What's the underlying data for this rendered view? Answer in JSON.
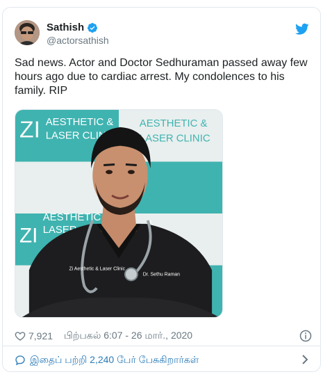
{
  "tweet": {
    "author_name": "Sathish",
    "author_handle": "@actorsathish",
    "text": "Sad news. Actor and Doctor Sedhuraman passed away few hours ago due to cardiac arrest. My condolences to his family. RIP",
    "image_alt": "Photo of a doctor in dark scrubs with a stethoscope in front of a ZI Aesthetic & Laser Clinic backdrop",
    "image_sign_text": "AESTHETIC & LASER CLINIC",
    "image_sign_logo": "ZI",
    "likes": "7,921",
    "timestamp": "பிற்பகல் 6:07 - 26 மார்., 2020",
    "conversation_label": "இதைப் பற்றி 2,240 பேர் பேசுகிறார்கள்"
  },
  "colors": {
    "verified": "#1da1f2",
    "twitter_bird": "#1da1f2",
    "link": "#2b7bb9",
    "muted": "#697882",
    "teal_sign": "#3fb3b0"
  },
  "icons": {
    "verified": "verified-badge-icon",
    "bird": "twitter-bird-icon",
    "heart": "heart-icon",
    "info": "info-icon",
    "reply": "speech-bubble-icon",
    "chevron": "chevron-right-icon"
  }
}
